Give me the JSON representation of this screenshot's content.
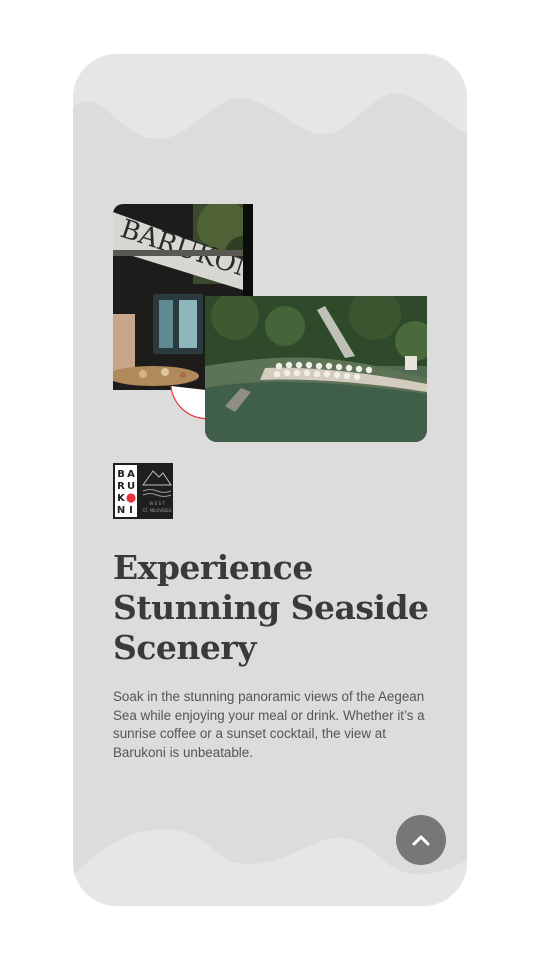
{
  "logo": {
    "letters": [
      "B",
      "A",
      "R",
      "U",
      "K",
      "O",
      "N",
      "I"
    ],
    "tagline_1": "W E S T",
    "tagline_2": "ST. MILOVIDES"
  },
  "section": {
    "headline": "Experience\nStunning Seaside\nScenery",
    "body": "Soak in the stunning panoramic views of the Aegean Sea while enjoying your meal or drink. Whether it’s a sunrise coffee or a sunset cocktail, the view at Barukoni is unbeatable."
  },
  "photos": {
    "restaurant_sign": "BARUKONI"
  },
  "scroll_top": {
    "icon": "chevron-up-icon"
  },
  "colors": {
    "card_bg": "#dcdcdc",
    "wave": "#e4e4e4",
    "heading": "#3a3a3a",
    "accent_red": "#e8323c",
    "button": "#777777"
  }
}
